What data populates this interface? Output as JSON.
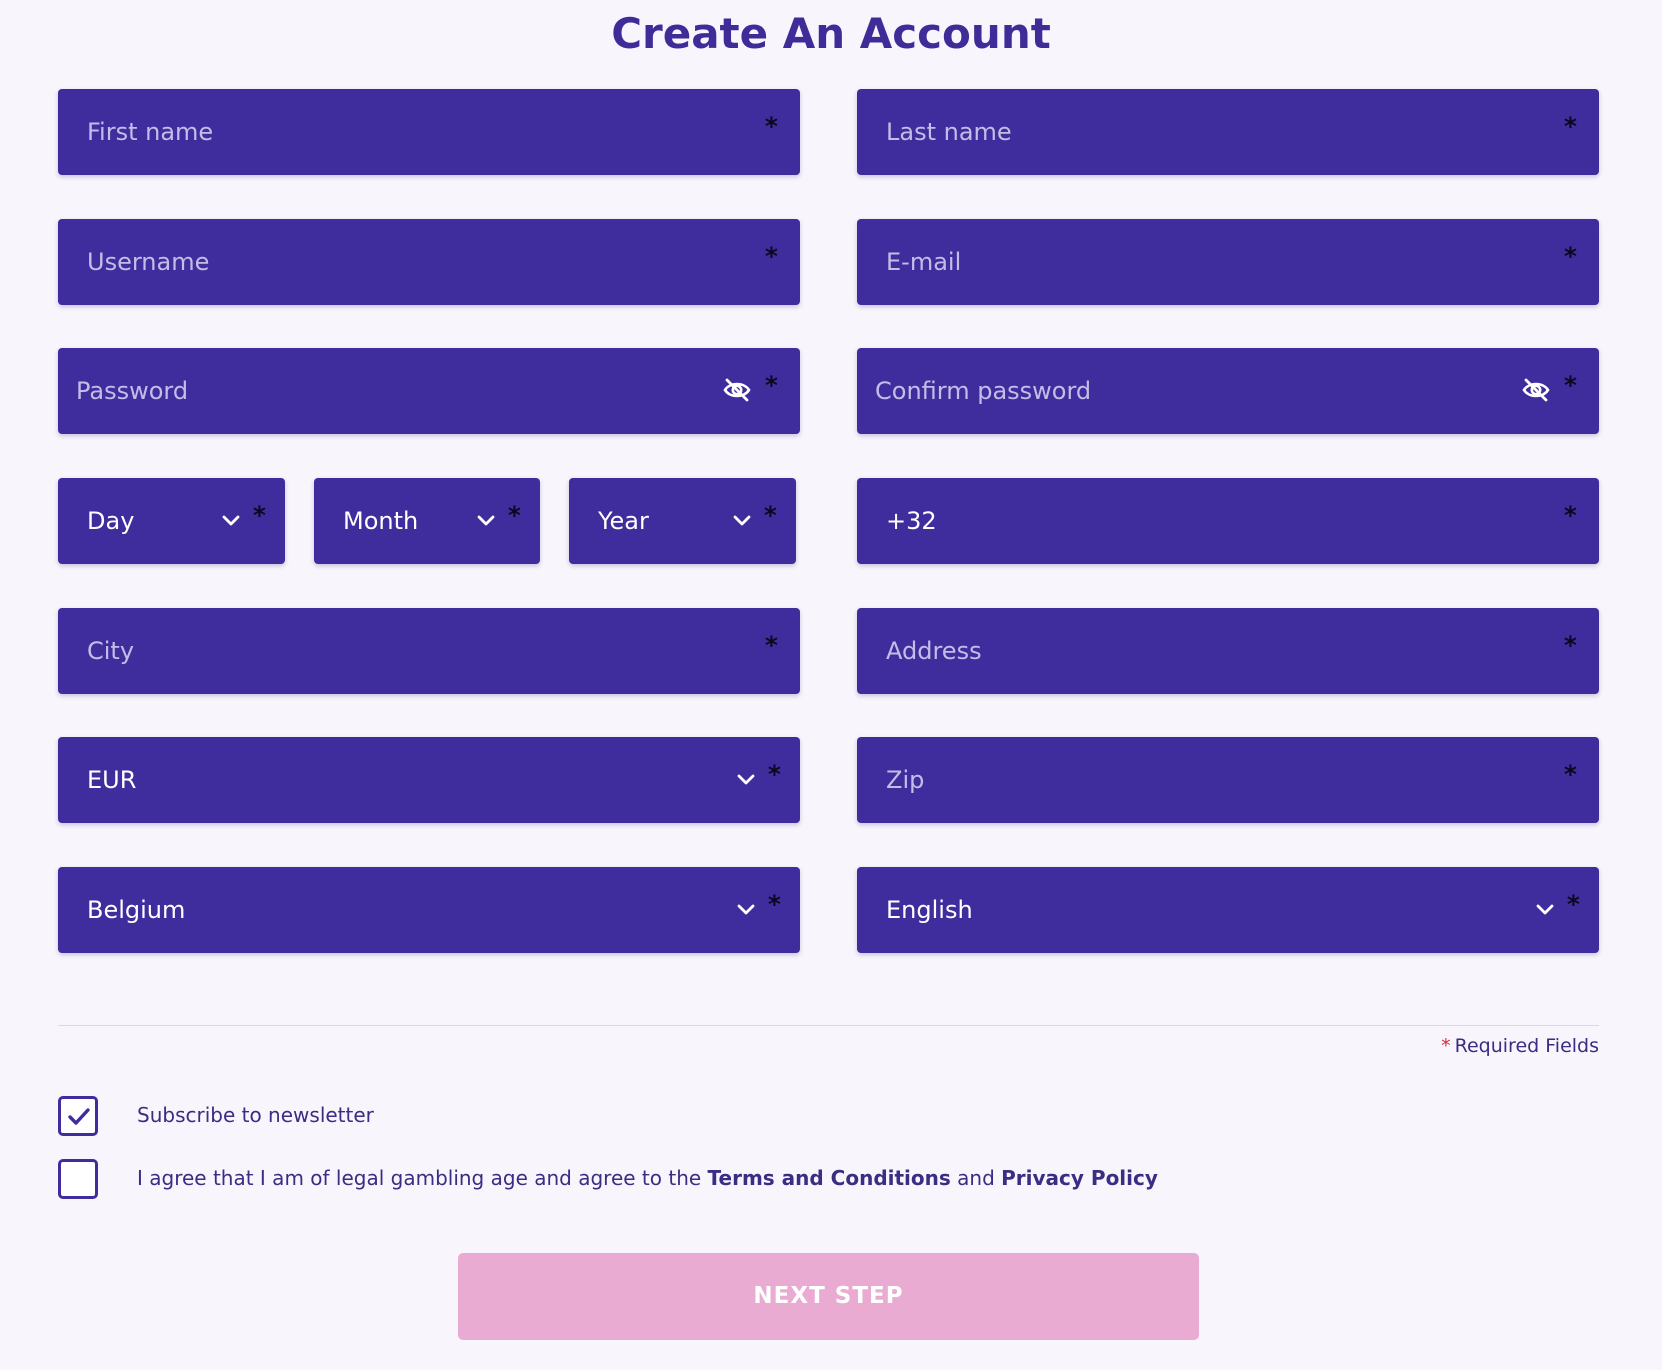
{
  "title": "Create An Account",
  "fields": {
    "first_name": {
      "placeholder": "First name",
      "required": "*"
    },
    "last_name": {
      "placeholder": "Last name",
      "required": "*"
    },
    "username": {
      "placeholder": "Username",
      "required": "*"
    },
    "email": {
      "placeholder": "E-mail",
      "required": "*"
    },
    "password": {
      "placeholder": "Password",
      "required": "*"
    },
    "confirm_password": {
      "placeholder": "Confirm password",
      "required": "*"
    },
    "day": {
      "value": "Day",
      "required": "*"
    },
    "month": {
      "value": "Month",
      "required": "*"
    },
    "year": {
      "value": "Year",
      "required": "*"
    },
    "phone": {
      "value": "+32",
      "required": "*"
    },
    "city": {
      "placeholder": "City",
      "required": "*"
    },
    "address": {
      "placeholder": "Address",
      "required": "*"
    },
    "currency": {
      "value": "EUR",
      "required": "*"
    },
    "zip": {
      "placeholder": "Zip",
      "required": "*"
    },
    "country": {
      "value": "Belgium",
      "required": "*"
    },
    "language": {
      "value": "English",
      "required": "*"
    }
  },
  "required_note": {
    "star": "*",
    "text": "Required Fields"
  },
  "newsletter": {
    "label": "Subscribe to newsletter",
    "checked": true
  },
  "terms": {
    "prefix": "I agree that I am of legal gambling age and agree to the ",
    "terms_link": "Terms and Conditions",
    "middle": " and ",
    "privacy_link": "Privacy Policy",
    "checked": false
  },
  "next_button": "NEXT STEP",
  "colors": {
    "background": "#f8f5fc",
    "field": "#3f2d9d",
    "title": "#3f2c98",
    "button": "#e9abd1",
    "required_star": "#d62b36"
  },
  "icons": {
    "password_toggle": "eye-off-icon",
    "select_arrow": "chevron-down-icon",
    "checkbox_mark": "checkmark-icon"
  }
}
